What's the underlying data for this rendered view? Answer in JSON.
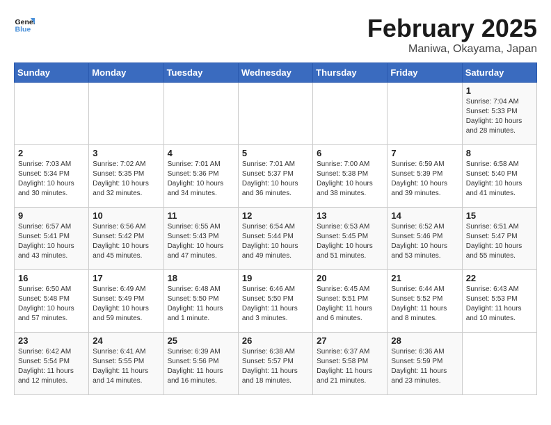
{
  "logo": {
    "line1": "General",
    "line2": "Blue"
  },
  "title": "February 2025",
  "subtitle": "Maniwa, Okayama, Japan",
  "days_of_week": [
    "Sunday",
    "Monday",
    "Tuesday",
    "Wednesday",
    "Thursday",
    "Friday",
    "Saturday"
  ],
  "weeks": [
    [
      {
        "day": "",
        "text": ""
      },
      {
        "day": "",
        "text": ""
      },
      {
        "day": "",
        "text": ""
      },
      {
        "day": "",
        "text": ""
      },
      {
        "day": "",
        "text": ""
      },
      {
        "day": "",
        "text": ""
      },
      {
        "day": "1",
        "text": "Sunrise: 7:04 AM\nSunset: 5:33 PM\nDaylight: 10 hours\nand 28 minutes."
      }
    ],
    [
      {
        "day": "2",
        "text": "Sunrise: 7:03 AM\nSunset: 5:34 PM\nDaylight: 10 hours\nand 30 minutes."
      },
      {
        "day": "3",
        "text": "Sunrise: 7:02 AM\nSunset: 5:35 PM\nDaylight: 10 hours\nand 32 minutes."
      },
      {
        "day": "4",
        "text": "Sunrise: 7:01 AM\nSunset: 5:36 PM\nDaylight: 10 hours\nand 34 minutes."
      },
      {
        "day": "5",
        "text": "Sunrise: 7:01 AM\nSunset: 5:37 PM\nDaylight: 10 hours\nand 36 minutes."
      },
      {
        "day": "6",
        "text": "Sunrise: 7:00 AM\nSunset: 5:38 PM\nDaylight: 10 hours\nand 38 minutes."
      },
      {
        "day": "7",
        "text": "Sunrise: 6:59 AM\nSunset: 5:39 PM\nDaylight: 10 hours\nand 39 minutes."
      },
      {
        "day": "8",
        "text": "Sunrise: 6:58 AM\nSunset: 5:40 PM\nDaylight: 10 hours\nand 41 minutes."
      }
    ],
    [
      {
        "day": "9",
        "text": "Sunrise: 6:57 AM\nSunset: 5:41 PM\nDaylight: 10 hours\nand 43 minutes."
      },
      {
        "day": "10",
        "text": "Sunrise: 6:56 AM\nSunset: 5:42 PM\nDaylight: 10 hours\nand 45 minutes."
      },
      {
        "day": "11",
        "text": "Sunrise: 6:55 AM\nSunset: 5:43 PM\nDaylight: 10 hours\nand 47 minutes."
      },
      {
        "day": "12",
        "text": "Sunrise: 6:54 AM\nSunset: 5:44 PM\nDaylight: 10 hours\nand 49 minutes."
      },
      {
        "day": "13",
        "text": "Sunrise: 6:53 AM\nSunset: 5:45 PM\nDaylight: 10 hours\nand 51 minutes."
      },
      {
        "day": "14",
        "text": "Sunrise: 6:52 AM\nSunset: 5:46 PM\nDaylight: 10 hours\nand 53 minutes."
      },
      {
        "day": "15",
        "text": "Sunrise: 6:51 AM\nSunset: 5:47 PM\nDaylight: 10 hours\nand 55 minutes."
      }
    ],
    [
      {
        "day": "16",
        "text": "Sunrise: 6:50 AM\nSunset: 5:48 PM\nDaylight: 10 hours\nand 57 minutes."
      },
      {
        "day": "17",
        "text": "Sunrise: 6:49 AM\nSunset: 5:49 PM\nDaylight: 10 hours\nand 59 minutes."
      },
      {
        "day": "18",
        "text": "Sunrise: 6:48 AM\nSunset: 5:50 PM\nDaylight: 11 hours\nand 1 minute."
      },
      {
        "day": "19",
        "text": "Sunrise: 6:46 AM\nSunset: 5:50 PM\nDaylight: 11 hours\nand 3 minutes."
      },
      {
        "day": "20",
        "text": "Sunrise: 6:45 AM\nSunset: 5:51 PM\nDaylight: 11 hours\nand 6 minutes."
      },
      {
        "day": "21",
        "text": "Sunrise: 6:44 AM\nSunset: 5:52 PM\nDaylight: 11 hours\nand 8 minutes."
      },
      {
        "day": "22",
        "text": "Sunrise: 6:43 AM\nSunset: 5:53 PM\nDaylight: 11 hours\nand 10 minutes."
      }
    ],
    [
      {
        "day": "23",
        "text": "Sunrise: 6:42 AM\nSunset: 5:54 PM\nDaylight: 11 hours\nand 12 minutes."
      },
      {
        "day": "24",
        "text": "Sunrise: 6:41 AM\nSunset: 5:55 PM\nDaylight: 11 hours\nand 14 minutes."
      },
      {
        "day": "25",
        "text": "Sunrise: 6:39 AM\nSunset: 5:56 PM\nDaylight: 11 hours\nand 16 minutes."
      },
      {
        "day": "26",
        "text": "Sunrise: 6:38 AM\nSunset: 5:57 PM\nDaylight: 11 hours\nand 18 minutes."
      },
      {
        "day": "27",
        "text": "Sunrise: 6:37 AM\nSunset: 5:58 PM\nDaylight: 11 hours\nand 21 minutes."
      },
      {
        "day": "28",
        "text": "Sunrise: 6:36 AM\nSunset: 5:59 PM\nDaylight: 11 hours\nand 23 minutes."
      },
      {
        "day": "",
        "text": ""
      }
    ]
  ]
}
